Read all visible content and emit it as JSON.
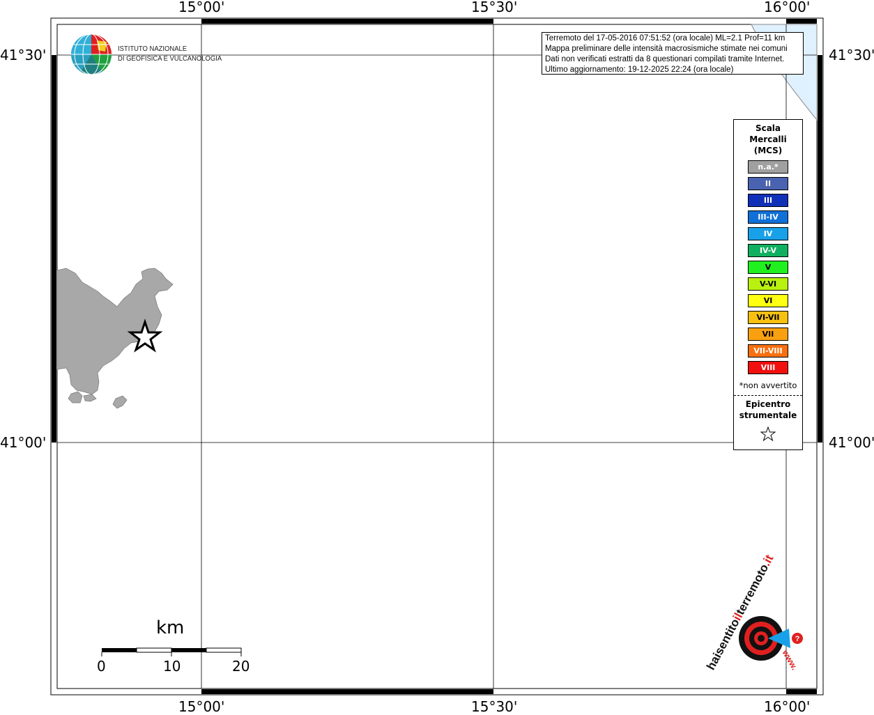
{
  "map": {
    "lon_labels": [
      "15°00'",
      "15°30'",
      "16°00'"
    ],
    "lat_labels": [
      "41°30'",
      "41°00'"
    ],
    "land_color": "#a8a8a8",
    "sea_color": "#dff0ff"
  },
  "logo": {
    "line1": "ISTITUTO NAZIONALE",
    "line2": "DI GEOFISICA E VULCANOLOGIA"
  },
  "info": {
    "line1": "Terremoto del 17-05-2016 07:51:52 (ora locale) ML=2.1 Prof=11 km",
    "line2": "Mappa preliminare delle intensità macrosismiche stimate nei comuni",
    "line3": "Dati non verificati estratti da 8 questionari compilati tramite Internet.",
    "line4": "Ultimo aggiornamento: 19-12-2025 22:24 (ora locale)"
  },
  "legend": {
    "title1": "Scala",
    "title2": "Mercalli",
    "title3": "(MCS)",
    "items": [
      {
        "label": "n.a.*",
        "color": "#a0a0a0"
      },
      {
        "label": "II",
        "color": "#4a63b0"
      },
      {
        "label": "III",
        "color": "#1030b8"
      },
      {
        "label": "III-IV",
        "color": "#1070d8"
      },
      {
        "label": "IV",
        "color": "#18a0e8"
      },
      {
        "label": "IV-V",
        "color": "#10b060"
      },
      {
        "label": "V",
        "color": "#20f020"
      },
      {
        "label": "V-VI",
        "color": "#b8f010"
      },
      {
        "label": "VI",
        "color": "#ffff10"
      },
      {
        "label": "VI-VII",
        "color": "#f8c010"
      },
      {
        "label": "VII",
        "color": "#f8a010"
      },
      {
        "label": "VII-VIII",
        "color": "#f87010"
      },
      {
        "label": "VIII",
        "color": "#f01010"
      }
    ],
    "note": "*non avvertito",
    "epicenter1": "Epicentro",
    "epicenter2": "strumentale"
  },
  "scalebar": {
    "unit": "km",
    "ticks": [
      "0",
      "10",
      "20"
    ]
  },
  "watermark": {
    "text1": "haisentito",
    "text2": "il",
    "text3": "terremoto",
    "text4": ".it",
    "text5": "www."
  }
}
